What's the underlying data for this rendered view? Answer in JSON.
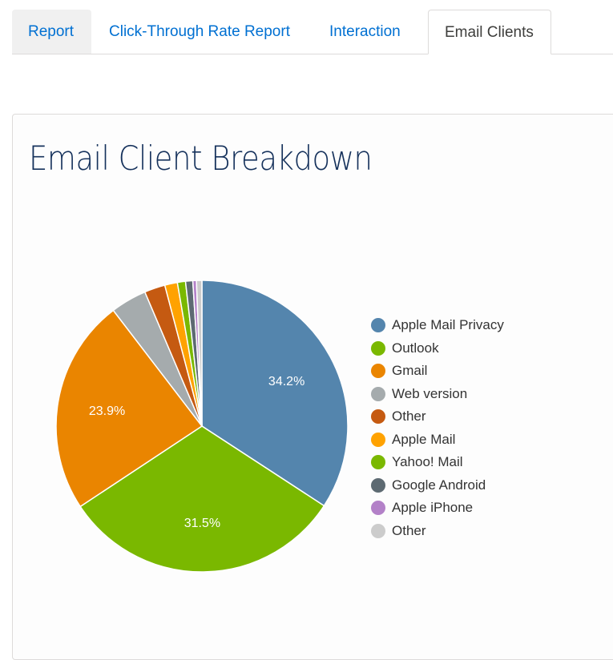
{
  "tabs": [
    {
      "label": "Report",
      "active": false
    },
    {
      "label": "Click-Through Rate Report",
      "active": false
    },
    {
      "label": "Interaction",
      "active": false
    },
    {
      "label": "Email Clients",
      "active": true
    }
  ],
  "card": {
    "title": "Email Client Breakdown"
  },
  "chart_data": {
    "type": "pie",
    "title": "Email Client Breakdown",
    "start": "top",
    "direction": "clockwise",
    "legend_position": "right",
    "slices": [
      {
        "label": "Apple Mail Privacy",
        "value": 34.2,
        "color": "#5485ad",
        "data_label": "34.2%"
      },
      {
        "label": "Outlook",
        "value": 31.5,
        "color": "#7ab800",
        "data_label": "31.5%"
      },
      {
        "label": "Gmail",
        "value": 23.9,
        "color": "#ea8500",
        "data_label": "23.9%"
      },
      {
        "label": "Web version",
        "value": 4.0,
        "color": "#a5abad",
        "data_label": ""
      },
      {
        "label": "Other",
        "value": 2.3,
        "color": "#c55a11",
        "data_label": ""
      },
      {
        "label": "Apple Mail",
        "value": 1.4,
        "color": "#ffa200",
        "data_label": ""
      },
      {
        "label": "Yahoo! Mail",
        "value": 0.9,
        "color": "#7ab800",
        "data_label": ""
      },
      {
        "label": "Google Android",
        "value": 0.8,
        "color": "#5d6a72",
        "data_label": ""
      },
      {
        "label": "Apple iPhone",
        "value": 0.4,
        "color": "#b381c8",
        "data_label": ""
      },
      {
        "label": "Other",
        "value": 0.6,
        "color": "#cccccc",
        "data_label": ""
      }
    ]
  }
}
